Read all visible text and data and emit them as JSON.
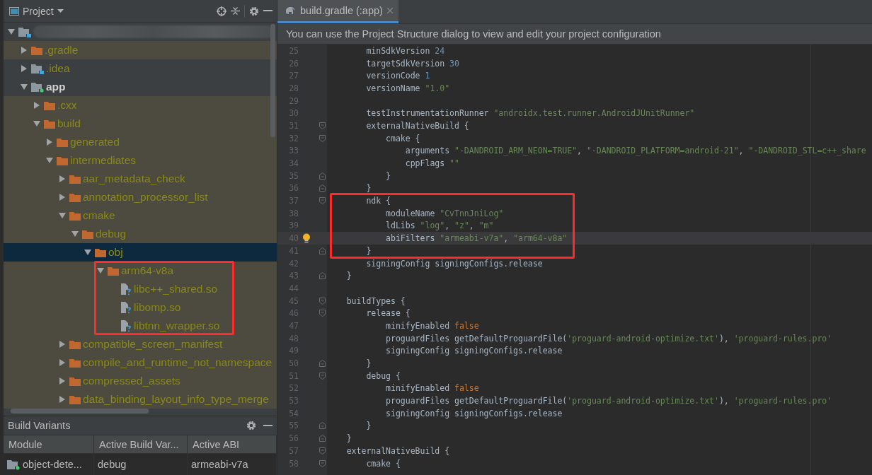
{
  "project_panel": {
    "title": "Project",
    "tree": [
      {
        "kind": "project",
        "expanded": true,
        "ignored": false,
        "selected": false,
        "highlighted": false,
        "children": [
          {
            "name": ".gradle",
            "kind": "folder",
            "expanded": false,
            "ignored": true,
            "selected": false,
            "highlighted": false
          },
          {
            "name": ".idea",
            "kind": "config-folder",
            "expanded": false,
            "ignored": false,
            "selected": false,
            "highlighted": false
          },
          {
            "name": "app",
            "kind": "module",
            "expanded": true,
            "ignored": false,
            "selected": false,
            "highlighted": false,
            "children": [
              {
                "name": ".cxx",
                "kind": "folder",
                "expanded": false,
                "ignored": true,
                "selected": false,
                "highlighted": false
              },
              {
                "name": "build",
                "kind": "folder",
                "expanded": true,
                "ignored": true,
                "selected": false,
                "highlighted": false,
                "children": [
                  {
                    "name": "generated",
                    "kind": "folder",
                    "expanded": false,
                    "ignored": true,
                    "selected": false,
                    "highlighted": false
                  },
                  {
                    "name": "intermediates",
                    "kind": "folder",
                    "expanded": true,
                    "ignored": true,
                    "selected": false,
                    "highlighted": false,
                    "children": [
                      {
                        "name": "aar_metadata_check",
                        "kind": "folder",
                        "expanded": false,
                        "ignored": true,
                        "selected": false,
                        "highlighted": false
                      },
                      {
                        "name": "annotation_processor_list",
                        "kind": "folder",
                        "expanded": false,
                        "ignored": true,
                        "selected": false,
                        "highlighted": false
                      },
                      {
                        "name": "cmake",
                        "kind": "folder",
                        "expanded": true,
                        "ignored": true,
                        "selected": false,
                        "highlighted": false,
                        "children": [
                          {
                            "name": "debug",
                            "kind": "folder",
                            "expanded": true,
                            "ignored": true,
                            "selected": false,
                            "highlighted": false,
                            "children": [
                              {
                                "name": "obj",
                                "kind": "folder",
                                "expanded": true,
                                "ignored": true,
                                "selected": true,
                                "highlighted": false,
                                "children": [
                                  {
                                    "name": "arm64-v8a",
                                    "kind": "folder",
                                    "expanded": true,
                                    "ignored": true,
                                    "selected": false,
                                    "highlighted": true,
                                    "children": [
                                      {
                                        "name": "libc++_shared.so",
                                        "kind": "file",
                                        "ignored": true,
                                        "selected": false,
                                        "highlighted": false
                                      },
                                      {
                                        "name": "libomp.so",
                                        "kind": "file",
                                        "ignored": true,
                                        "selected": false,
                                        "highlighted": false
                                      },
                                      {
                                        "name": "libtnn_wrapper.so",
                                        "kind": "file",
                                        "ignored": true,
                                        "selected": false,
                                        "highlighted": false
                                      }
                                    ]
                                  }
                                ]
                              }
                            ]
                          }
                        ]
                      },
                      {
                        "name": "compatible_screen_manifest",
                        "kind": "folder",
                        "expanded": false,
                        "ignored": true,
                        "selected": false,
                        "highlighted": false
                      },
                      {
                        "name": "compile_and_runtime_not_namespace",
                        "kind": "folder",
                        "expanded": false,
                        "ignored": true,
                        "selected": false,
                        "highlighted": false
                      },
                      {
                        "name": "compressed_assets",
                        "kind": "folder",
                        "expanded": false,
                        "ignored": true,
                        "selected": false,
                        "highlighted": false
                      },
                      {
                        "name": "data_binding_layout_info_type_merge",
                        "kind": "folder",
                        "expanded": false,
                        "ignored": true,
                        "selected": false,
                        "highlighted": false
                      }
                    ]
                  }
                ]
              }
            ]
          }
        ]
      }
    ]
  },
  "build_variants": {
    "title": "Build Variants",
    "columns": [
      "Module",
      "Active Build Var...",
      "Active ABI"
    ],
    "rows": [
      [
        "object-dete...",
        "debug",
        "armeabi-v7a"
      ]
    ]
  },
  "editor": {
    "tabs": [
      {
        "label": "build.gradle (:app)",
        "selected": true
      }
    ],
    "banner": "You can use the Project Structure dialog to view and edit your project configuration",
    "lines": [
      {
        "number": "25",
        "current": false,
        "highlighted": false,
        "tokens": [
          {
            "text": "        minSdkVersion ",
            "kind": "plain"
          },
          {
            "text": "24",
            "kind": "number"
          }
        ]
      },
      {
        "number": "26",
        "current": false,
        "highlighted": false,
        "tokens": [
          {
            "text": "        targetSdkVersion ",
            "kind": "plain"
          },
          {
            "text": "30",
            "kind": "number"
          }
        ]
      },
      {
        "number": "27",
        "current": false,
        "highlighted": false,
        "tokens": [
          {
            "text": "        versionCode ",
            "kind": "plain"
          },
          {
            "text": "1",
            "kind": "number"
          }
        ]
      },
      {
        "number": "28",
        "current": false,
        "highlighted": false,
        "tokens": [
          {
            "text": "        versionName ",
            "kind": "plain"
          },
          {
            "text": "\"1.0\"",
            "kind": "string"
          }
        ]
      },
      {
        "number": "29",
        "current": false,
        "highlighted": false
      },
      {
        "number": "30",
        "current": false,
        "highlighted": false,
        "tokens": [
          {
            "text": "        testInstrumentationRunner ",
            "kind": "plain"
          },
          {
            "text": "\"androidx.test.runner.AndroidJUnitRunner\"",
            "kind": "string"
          }
        ]
      },
      {
        "number": "31",
        "current": false,
        "highlighted": false,
        "fold_start": true,
        "tokens": [
          {
            "text": "        externalNativeBuild {",
            "kind": "plain"
          }
        ]
      },
      {
        "number": "32",
        "current": false,
        "highlighted": false,
        "fold_start": true,
        "tokens": [
          {
            "text": "            cmake {",
            "kind": "plain"
          }
        ]
      },
      {
        "number": "33",
        "current": false,
        "highlighted": false,
        "tokens": [
          {
            "text": "                arguments ",
            "kind": "plain"
          },
          {
            "text": "\"-DANDROID_ARM_NEON=TRUE\"",
            "kind": "string"
          },
          {
            "text": ", ",
            "kind": "plain"
          },
          {
            "text": "\"-DANDROID_PLATFORM=android-21\"",
            "kind": "string"
          },
          {
            "text": ", ",
            "kind": "plain"
          },
          {
            "text": "\"-DANDROID_STL=c++_share",
            "kind": "string"
          }
        ]
      },
      {
        "number": "34",
        "current": false,
        "highlighted": false,
        "tokens": [
          {
            "text": "                cppFlags ",
            "kind": "plain"
          },
          {
            "text": "\"\"",
            "kind": "string"
          }
        ]
      },
      {
        "number": "35",
        "current": false,
        "highlighted": false,
        "fold_end": true,
        "tokens": [
          {
            "text": "            }",
            "kind": "plain"
          }
        ]
      },
      {
        "number": "36",
        "current": false,
        "highlighted": false,
        "fold_end": true,
        "tokens": [
          {
            "text": "        }",
            "kind": "plain"
          }
        ]
      },
      {
        "number": "37",
        "current": false,
        "highlighted": true,
        "fold_start": true,
        "tokens": [
          {
            "text": "        ndk {",
            "kind": "plain"
          }
        ]
      },
      {
        "number": "38",
        "current": false,
        "highlighted": true,
        "tokens": [
          {
            "text": "            moduleName ",
            "kind": "plain"
          },
          {
            "text": "\"CvTnnJniLog\"",
            "kind": "string"
          }
        ]
      },
      {
        "number": "39",
        "current": false,
        "highlighted": true,
        "tokens": [
          {
            "text": "            ldLibs ",
            "kind": "plain"
          },
          {
            "text": "\"log\"",
            "kind": "string"
          },
          {
            "text": ", ",
            "kind": "plain"
          },
          {
            "text": "\"z\"",
            "kind": "string"
          },
          {
            "text": ", ",
            "kind": "plain"
          },
          {
            "text": "\"m\"",
            "kind": "string"
          }
        ]
      },
      {
        "number": "40",
        "current": true,
        "highlighted": true,
        "bulb": true,
        "tokens": [
          {
            "text": "            abiFilters ",
            "kind": "plain"
          },
          {
            "text": "\"armeabi-v7a\"",
            "kind": "string"
          },
          {
            "text": ", ",
            "kind": "plain"
          },
          {
            "text": "\"arm64-v8a\"",
            "kind": "string"
          }
        ]
      },
      {
        "number": "41",
        "current": false,
        "highlighted": true,
        "fold_end": true,
        "tokens": [
          {
            "text": "        }",
            "kind": "plain"
          }
        ]
      },
      {
        "number": "42",
        "current": false,
        "highlighted": false,
        "tokens": [
          {
            "text": "        signingConfig signingConfigs.release",
            "kind": "plain"
          }
        ]
      },
      {
        "number": "43",
        "current": false,
        "highlighted": false,
        "fold_end": true,
        "tokens": [
          {
            "text": "    }",
            "kind": "plain"
          }
        ]
      },
      {
        "number": "44",
        "current": false,
        "highlighted": false
      },
      {
        "number": "45",
        "current": false,
        "highlighted": false,
        "fold_start": true,
        "tokens": [
          {
            "text": "    buildTypes {",
            "kind": "plain"
          }
        ]
      },
      {
        "number": "46",
        "current": false,
        "highlighted": false,
        "fold_start": true,
        "tokens": [
          {
            "text": "        release {",
            "kind": "plain"
          }
        ]
      },
      {
        "number": "47",
        "current": false,
        "highlighted": false,
        "tokens": [
          {
            "text": "            minifyEnabled ",
            "kind": "plain"
          },
          {
            "text": "false",
            "kind": "keyword"
          }
        ]
      },
      {
        "number": "48",
        "current": false,
        "highlighted": false,
        "tokens": [
          {
            "text": "            proguardFiles getDefaultProguardFile(",
            "kind": "plain"
          },
          {
            "text": "'proguard-android-optimize.txt'",
            "kind": "string"
          },
          {
            "text": "), ",
            "kind": "plain"
          },
          {
            "text": "'proguard-rules.pro'",
            "kind": "string"
          }
        ]
      },
      {
        "number": "49",
        "current": false,
        "highlighted": false,
        "tokens": [
          {
            "text": "            signingConfig signingConfigs.release",
            "kind": "plain"
          }
        ]
      },
      {
        "number": "50",
        "current": false,
        "highlighted": false,
        "fold_end": true,
        "tokens": [
          {
            "text": "        }",
            "kind": "plain"
          }
        ]
      },
      {
        "number": "51",
        "current": false,
        "highlighted": false,
        "fold_start": true,
        "tokens": [
          {
            "text": "        debug {",
            "kind": "plain"
          }
        ]
      },
      {
        "number": "52",
        "current": false,
        "highlighted": false,
        "tokens": [
          {
            "text": "            minifyEnabled ",
            "kind": "plain"
          },
          {
            "text": "false",
            "kind": "keyword"
          }
        ]
      },
      {
        "number": "53",
        "current": false,
        "highlighted": false,
        "tokens": [
          {
            "text": "            proguardFiles getDefaultProguardFile(",
            "kind": "plain"
          },
          {
            "text": "'proguard-android-optimize.txt'",
            "kind": "string"
          },
          {
            "text": "), ",
            "kind": "plain"
          },
          {
            "text": "'proguard-rules.pro'",
            "kind": "string"
          }
        ]
      },
      {
        "number": "54",
        "current": false,
        "highlighted": false,
        "tokens": [
          {
            "text": "            signingConfig signingConfigs.release",
            "kind": "plain"
          }
        ]
      },
      {
        "number": "55",
        "current": false,
        "highlighted": false,
        "fold_end": true,
        "tokens": [
          {
            "text": "        }",
            "kind": "plain"
          }
        ]
      },
      {
        "number": "56",
        "current": false,
        "highlighted": false,
        "fold_end": true,
        "tokens": [
          {
            "text": "    }",
            "kind": "plain"
          }
        ]
      },
      {
        "number": "57",
        "current": false,
        "highlighted": false,
        "fold_start": true,
        "tokens": [
          {
            "text": "    externalNativeBuild {",
            "kind": "plain"
          }
        ]
      },
      {
        "number": "58",
        "current": false,
        "highlighted": false,
        "fold_start": true,
        "tokens": [
          {
            "text": "        cmake {",
            "kind": "plain"
          }
        ]
      }
    ]
  }
}
